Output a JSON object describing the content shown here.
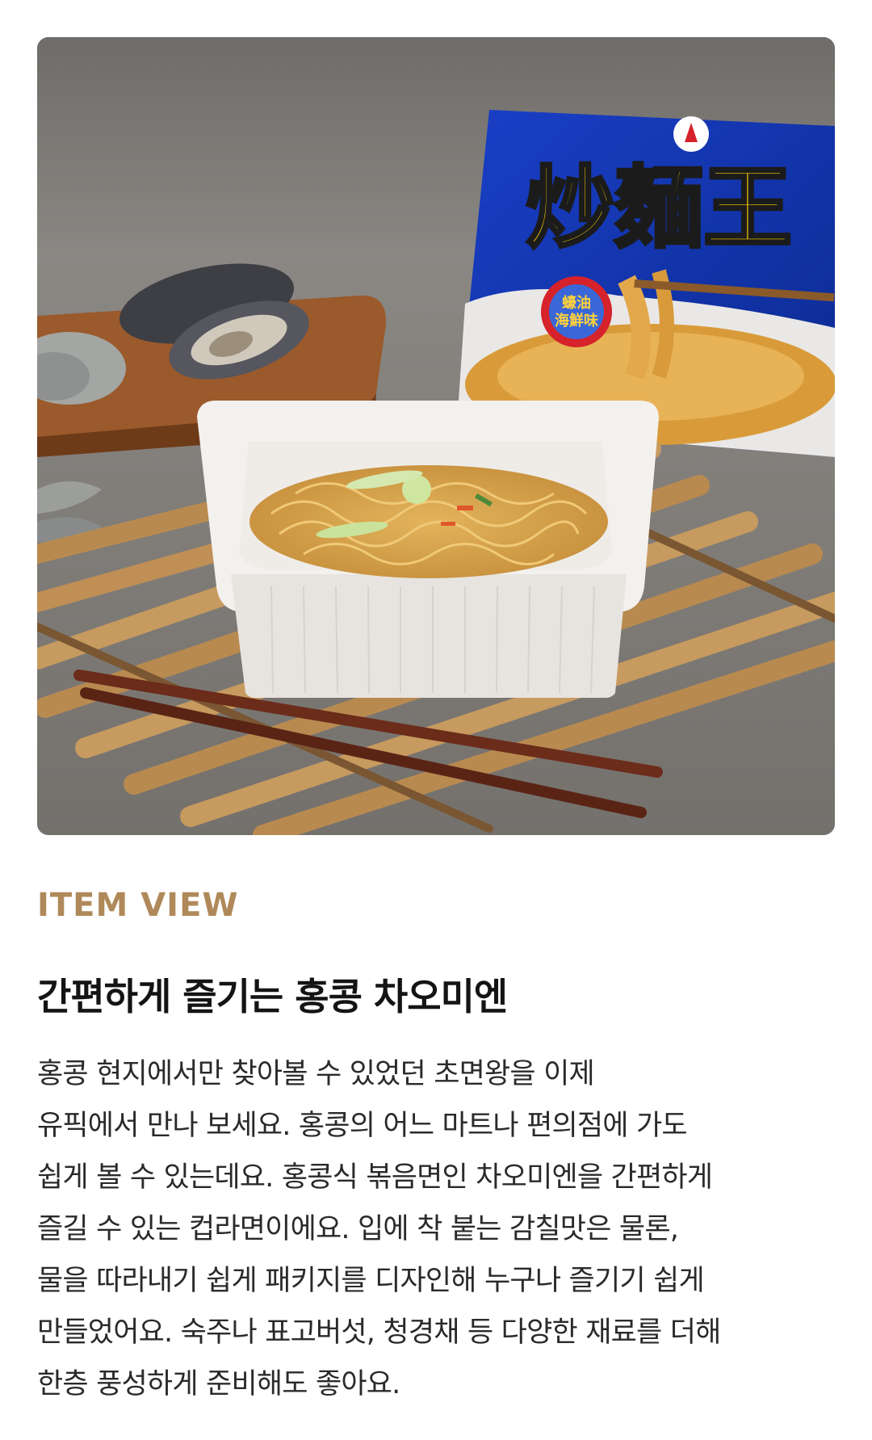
{
  "hero_image": {
    "alt_icon": "product-photo",
    "package_text": "炒麵王",
    "package_badge": "蠔油\n海鮮味"
  },
  "eyebrow": "ITEM VIEW",
  "title": "간편하게 즐기는 홍콩 차오미엔",
  "description_lines": [
    "홍콩 현지에서만 찾아볼 수 있었던 초면왕을 이제",
    "유픽에서 만나 보세요. 홍콩의 어느 마트나 편의점에 가도",
    "쉽게 볼 수 있는데요. 홍콩식 볶음면인 차오미엔을 간편하게",
    "즐길 수 있는 컵라면이에요. 입에 착 붙는 감칠맛은 물론,",
    "물을 따라내기 쉽게 패키지를 디자인해 누구나 즐기기 쉽게",
    "만들었어요. 숙주나 표고버섯, 청경채 등 다양한 재료를 더해",
    "한층 풍성하게 준비해도 좋아요."
  ],
  "colors": {
    "eyebrow": "#b0895a",
    "title": "#141414",
    "body": "#2a2a2a"
  }
}
